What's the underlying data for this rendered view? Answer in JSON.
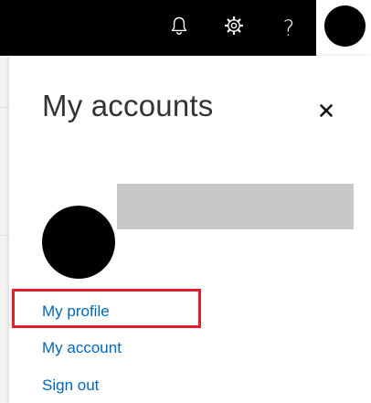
{
  "header": {
    "notifications_icon": "bell-icon",
    "settings_icon": "gear-icon",
    "help_label": "?",
    "account_icon": "avatar"
  },
  "panel": {
    "title": "My accounts",
    "close_label": "×",
    "links": [
      {
        "label": "My profile"
      },
      {
        "label": "My account"
      },
      {
        "label": "Sign out"
      }
    ]
  },
  "colors": {
    "topbar": "#000000",
    "link": "#0067b8",
    "highlight": "#e2202e",
    "redaction": "#c8c8c8"
  }
}
